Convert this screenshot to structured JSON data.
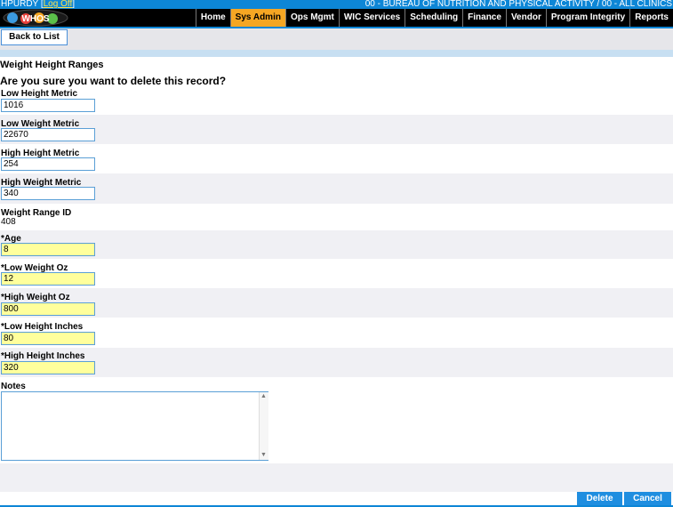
{
  "header": {
    "user": "HPURDY",
    "log_off": "Log Off",
    "org": "00 - BUREAU OF NUTRITION AND PHYSICAL ACTIVITY / 00 - ALL CLINICS",
    "logo_text": "WHOS"
  },
  "nav": {
    "items": [
      "Home",
      "Sys Admin",
      "Ops Mgmt",
      "WIC Services",
      "Scheduling",
      "Finance",
      "Vendor",
      "Program Integrity",
      "Reports"
    ],
    "active": "Sys Admin"
  },
  "toolbar": {
    "back_label": "Back to List"
  },
  "page": {
    "title": "Weight Height Ranges",
    "prompt": "Are you sure you want to delete this record?"
  },
  "fields": {
    "low_height_metric": {
      "label": "Low Height Metric",
      "value": "1016"
    },
    "low_weight_metric": {
      "label": "Low Weight Metric",
      "value": "22670"
    },
    "high_height_metric": {
      "label": "High Height Metric",
      "value": "254"
    },
    "high_weight_metric": {
      "label": "High Weight Metric",
      "value": "340"
    },
    "weight_range_id": {
      "label": "Weight Range ID",
      "value": "408"
    },
    "age": {
      "label": "*Age",
      "value": "8"
    },
    "low_weight_oz": {
      "label": "*Low Weight Oz",
      "value": "12"
    },
    "high_weight_oz": {
      "label": "*High Weight Oz",
      "value": "800"
    },
    "low_height_inches": {
      "label": "*Low Height Inches",
      "value": "80"
    },
    "high_height_inches": {
      "label": "*High Height Inches",
      "value": "320"
    },
    "notes": {
      "label": "Notes",
      "value": ""
    }
  },
  "actions": {
    "delete_label": "Delete",
    "cancel_label": "Cancel"
  },
  "colors": {
    "accent": "#0d86d6",
    "active_tab": "#f5a623",
    "required_bg": "#ffff9c",
    "button": "#1f8ee0"
  }
}
